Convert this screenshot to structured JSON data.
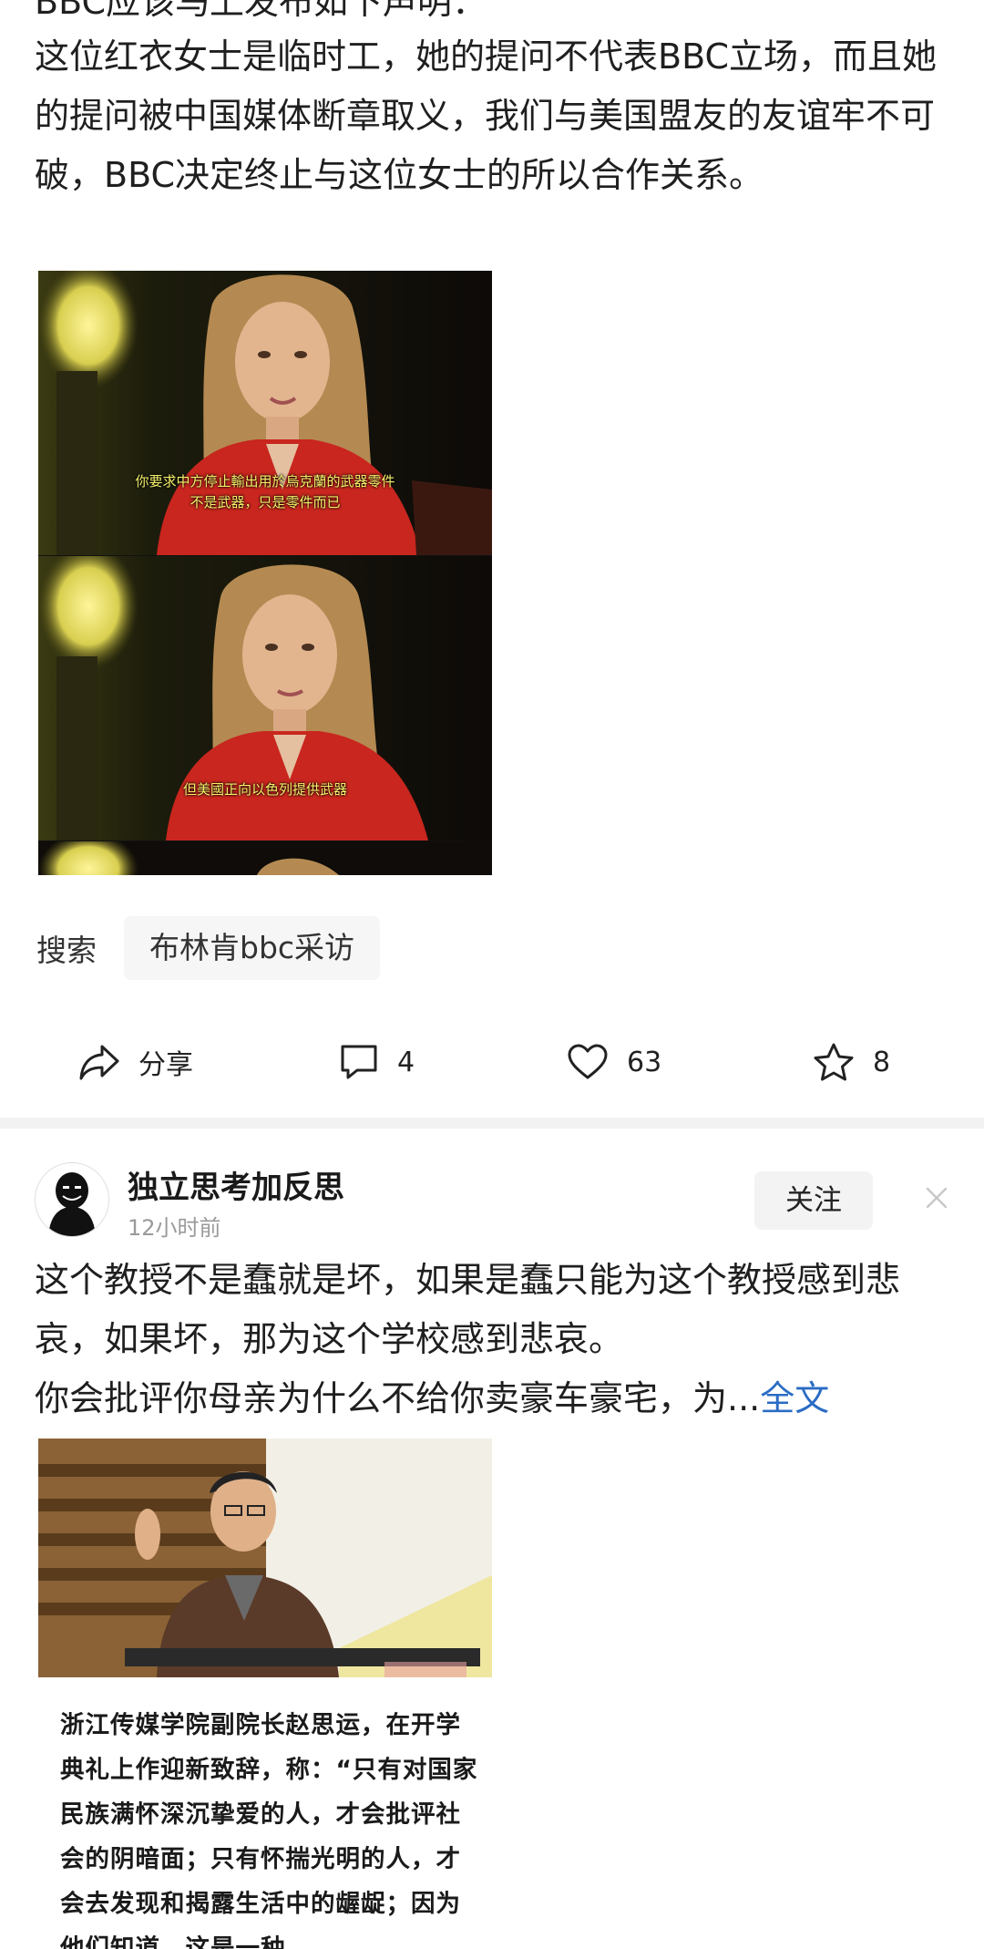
{
  "post1": {
    "cut_line": "BBC应该马上发布如下声明：",
    "body": "这位红衣女士是临时工，她的提问不代表BBC立场，而且她的提问被中国媒体断章取义，我们与美国盟友的友谊牢不可破，BBC决定终止与这位女士的所以合作关系。",
    "subtitle_1a": "你要求中方停止輸出用於烏克蘭的武器零件",
    "subtitle_1b": "不是武器，只是零件而已",
    "subtitle_2": "但美國正向以色列提供武器",
    "search_label": "搜索",
    "search_chip": "布林肯bbc采访",
    "actions": {
      "share_label": "分享",
      "comment_count": "4",
      "like_count": "63",
      "fav_count": "8"
    }
  },
  "post2": {
    "author": "独立思考加反思",
    "time": "12小时前",
    "follow_label": "关注",
    "body": "这个教授不是蠢就是坏，如果是蠢只能为这个教授感到悲哀，如果坏，那为这个学校感到悲哀。",
    "body2": "你会批评你母亲为什么不给你卖豪车豪宅，为...",
    "full_text_link": "全文",
    "article_text": "浙江传媒学院副院长赵思运，在开学典礼上作迎新致辞，称：“只有对国家民族满怀深沉挚爱的人，才会批评社会的阴暗面；只有怀揣光明的人，才会去发现和揭露生活中的龌龊；因为他们知道，这是一种"
  },
  "colors": {
    "link": "#2b6cc4",
    "subtitle": "#f5f06a",
    "divider": "#f2f2f2"
  }
}
